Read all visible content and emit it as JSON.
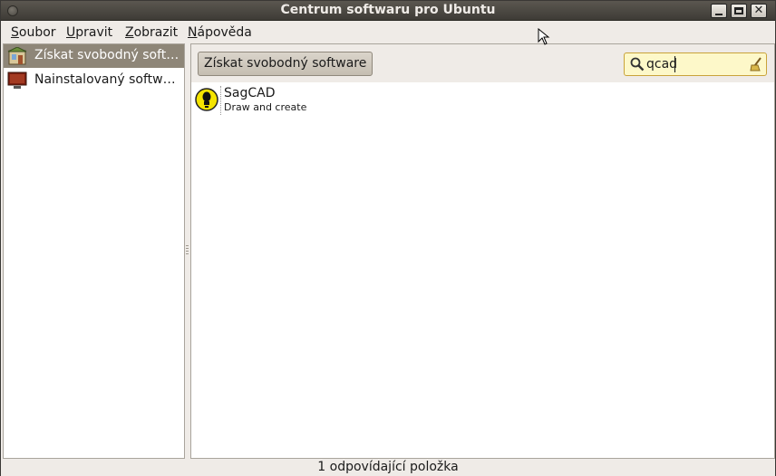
{
  "window": {
    "title": "Centrum softwaru pro Ubuntu",
    "close_glyph": "✕"
  },
  "menubar": {
    "items": [
      {
        "label": "Soubor",
        "mnemonic": "S",
        "rest": "oubor"
      },
      {
        "label": "Upravit",
        "mnemonic": "U",
        "rest": "pravit"
      },
      {
        "label": "Zobrazit",
        "mnemonic": "Z",
        "rest": "obrazit"
      },
      {
        "label": "Nápověda",
        "mnemonic": "N",
        "rest": "ápověda"
      }
    ]
  },
  "sidebar": {
    "items": [
      {
        "label": "Získat svobodný software",
        "display": "Získat svobodný softw...",
        "icon": "software-store-icon",
        "selected": true
      },
      {
        "label": "Nainstalovaný software",
        "display": "Nainstalovaný software",
        "icon": "installed-monitor-icon",
        "selected": false
      }
    ]
  },
  "toolbar": {
    "breadcrumb": "Získat svobodný software",
    "search_value": "qcad"
  },
  "results": [
    {
      "name": "SagCAD",
      "summary": "Draw and create",
      "icon": "sagcad-icon"
    }
  ],
  "status": {
    "text": "1 odpovídající položka"
  },
  "colors": {
    "titlebar": "#3e3b36",
    "selection": "#8e8678",
    "search_bg": "#fdf8c9"
  }
}
